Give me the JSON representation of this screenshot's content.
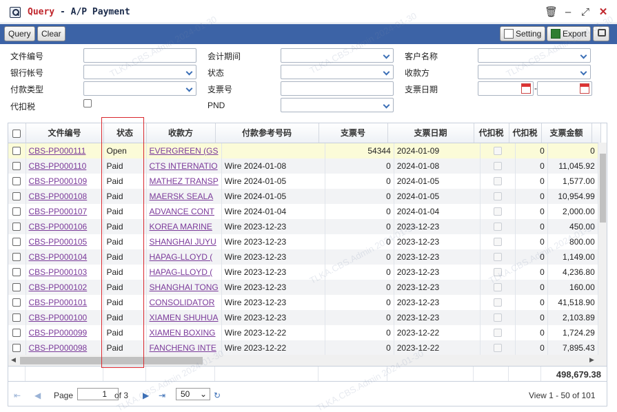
{
  "window": {
    "title_prefix": "Query",
    "title_rest": "- A/P Payment",
    "icons": {
      "app": "search-window-icon",
      "delete": "trash-icon",
      "minimize": "minimize-icon",
      "maximize": "maximize-icon",
      "close": "close-icon"
    }
  },
  "toolbar": {
    "query": "Query",
    "clear": "Clear",
    "setting": "Setting",
    "export": "Export"
  },
  "form": {
    "file_no": "文件编号",
    "bank_account": "银行帐号",
    "payment_type": "付款类型",
    "withholding_tax": "代扣税",
    "accounting_period": "会计期间",
    "status": "状态",
    "cheque_no": "支票号",
    "pnd": "PND",
    "customer_name": "客户名称",
    "payee": "收款方",
    "cheque_date": "支票日期",
    "date_sep": "-"
  },
  "grid": {
    "columns": [
      "文件编号",
      "状态",
      "收款方",
      "付款参考号码",
      "支票号",
      "支票日期",
      "代扣税",
      "代扣税",
      "支票金额"
    ],
    "rows": [
      {
        "no": "CBS-PP000111",
        "status": "Open",
        "payee": "EVERGREEN (GS",
        "ref": "",
        "cheque": "54344",
        "date": "2024-01-09",
        "wht": "0",
        "amount": "0"
      },
      {
        "no": "CBS-PP000110",
        "status": "Paid",
        "payee": "CTS INTERNATIO",
        "ref": "Wire 2024-01-08",
        "cheque": "0",
        "date": "2024-01-08",
        "wht": "0",
        "amount": "11,045.92"
      },
      {
        "no": "CBS-PP000109",
        "status": "Paid",
        "payee": "MATHEZ TRANSP",
        "ref": "Wire 2024-01-05",
        "cheque": "0",
        "date": "2024-01-05",
        "wht": "0",
        "amount": "1,577.00"
      },
      {
        "no": "CBS-PP000108",
        "status": "Paid",
        "payee": "MAERSK SEALA",
        "ref": "Wire 2024-01-05",
        "cheque": "0",
        "date": "2024-01-05",
        "wht": "0",
        "amount": "10,954.99"
      },
      {
        "no": "CBS-PP000107",
        "status": "Paid",
        "payee": "ADVANCE CONT",
        "ref": "Wire 2024-01-04",
        "cheque": "0",
        "date": "2024-01-04",
        "wht": "0",
        "amount": "2,000.00"
      },
      {
        "no": "CBS-PP000106",
        "status": "Paid",
        "payee": "KOREA MARINE",
        "ref": "Wire 2023-12-23",
        "cheque": "0",
        "date": "2023-12-23",
        "wht": "0",
        "amount": "450.00"
      },
      {
        "no": "CBS-PP000105",
        "status": "Paid",
        "payee": "SHANGHAI JUYU",
        "ref": "Wire 2023-12-23",
        "cheque": "0",
        "date": "2023-12-23",
        "wht": "0",
        "amount": "800.00"
      },
      {
        "no": "CBS-PP000104",
        "status": "Paid",
        "payee": "HAPAG-LLOYD (",
        "ref": "Wire 2023-12-23",
        "cheque": "0",
        "date": "2023-12-23",
        "wht": "0",
        "amount": "1,149.00"
      },
      {
        "no": "CBS-PP000103",
        "status": "Paid",
        "payee": "HAPAG-LLOYD (",
        "ref": "Wire 2023-12-23",
        "cheque": "0",
        "date": "2023-12-23",
        "wht": "0",
        "amount": "4,236.80"
      },
      {
        "no": "CBS-PP000102",
        "status": "Paid",
        "payee": "SHANGHAI TONG",
        "ref": "Wire 2023-12-23",
        "cheque": "0",
        "date": "2023-12-23",
        "wht": "0",
        "amount": "160.00"
      },
      {
        "no": "CBS-PP000101",
        "status": "Paid",
        "payee": "CONSOLIDATOR",
        "ref": "Wire 2023-12-23",
        "cheque": "0",
        "date": "2023-12-23",
        "wht": "0",
        "amount": "41,518.90"
      },
      {
        "no": "CBS-PP000100",
        "status": "Paid",
        "payee": "XIAMEN SHUHUA",
        "ref": "Wire 2023-12-23",
        "cheque": "0",
        "date": "2023-12-23",
        "wht": "0",
        "amount": "2,103.89"
      },
      {
        "no": "CBS-PP000099",
        "status": "Paid",
        "payee": "XIAMEN BOXING",
        "ref": "Wire 2023-12-22",
        "cheque": "0",
        "date": "2023-12-22",
        "wht": "0",
        "amount": "1,724.29"
      },
      {
        "no": "CBS-PP000098",
        "status": "Paid",
        "payee": "FANCHENG INTE",
        "ref": "Wire 2023-12-22",
        "cheque": "0",
        "date": "2023-12-22",
        "wht": "0",
        "amount": "7,895.43"
      }
    ],
    "total": "498,679.38"
  },
  "pager": {
    "page_label": "Page",
    "page_value": "1",
    "of_label": "of 3",
    "page_size": "50",
    "view_text": "View 1 - 50 of 101"
  },
  "watermark": "TLKA.CBS.Admin 2024-01-30",
  "colors": {
    "toolbar": "#3c63a6",
    "title_red": "#c0262c",
    "link": "#7b3a9a",
    "highlight": "#d9262c"
  }
}
